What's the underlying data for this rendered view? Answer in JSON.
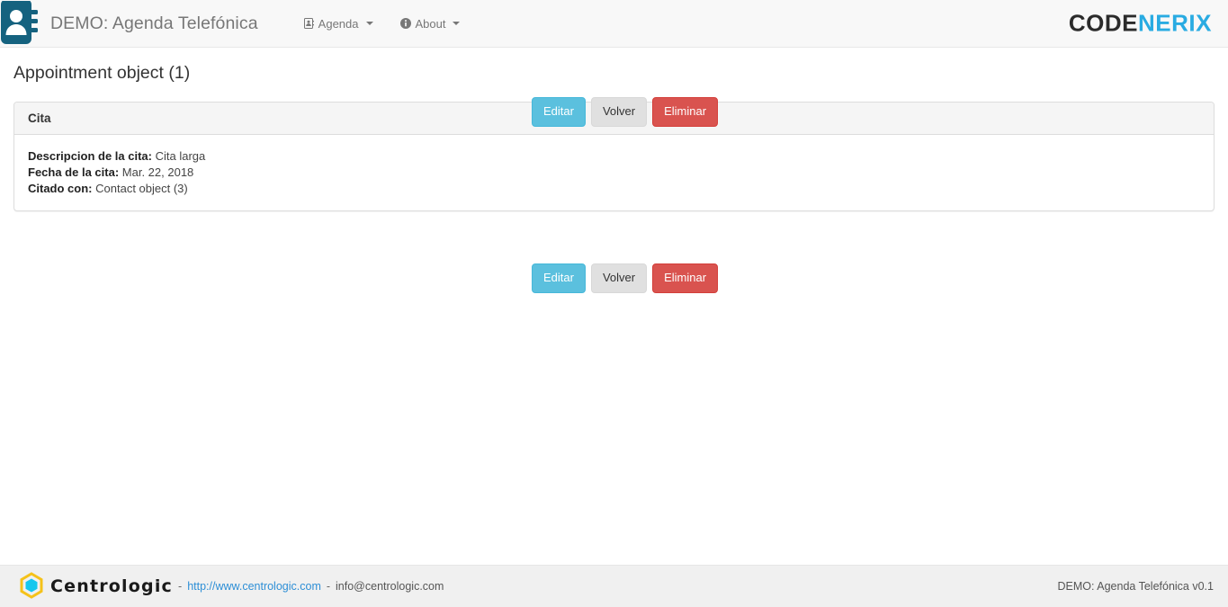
{
  "navbar": {
    "brand_icon": "address-book-icon",
    "brand_title": "DEMO: Agenda Telefónica",
    "items": [
      {
        "label": "Agenda",
        "icon": "address-book-icon",
        "has_caret": true
      },
      {
        "label": "About",
        "icon": "info-circle-icon",
        "has_caret": true
      }
    ],
    "logo": {
      "part1": "CODE",
      "part2": "NERIX",
      "color1": "#2b2b2b",
      "color2": "#29abe2"
    }
  },
  "page": {
    "title": "Appointment object (1)"
  },
  "actions": {
    "edit_label": "Editar",
    "back_label": "Volver",
    "delete_label": "Eliminar",
    "colors": {
      "edit": "#5bc0de",
      "back": "#e0e0e0",
      "delete": "#d9534f"
    }
  },
  "panel": {
    "title": "Cita",
    "fields": [
      {
        "label": "Descripcion de la cita:",
        "value": "Cita larga"
      },
      {
        "label": "Fecha de la cita:",
        "value": "Mar. 22, 2018"
      },
      {
        "label": "Citado con:",
        "value": "Contact object (3)"
      }
    ]
  },
  "footer": {
    "brand_icon": "hexagon-logo-icon",
    "brand_name": "Centrologic",
    "sep1": "-",
    "url": "http://www.centrologic.com",
    "sep2": "-",
    "email": "info@centrologic.com",
    "version": "DEMO: Agenda Telefónica v0.1"
  }
}
